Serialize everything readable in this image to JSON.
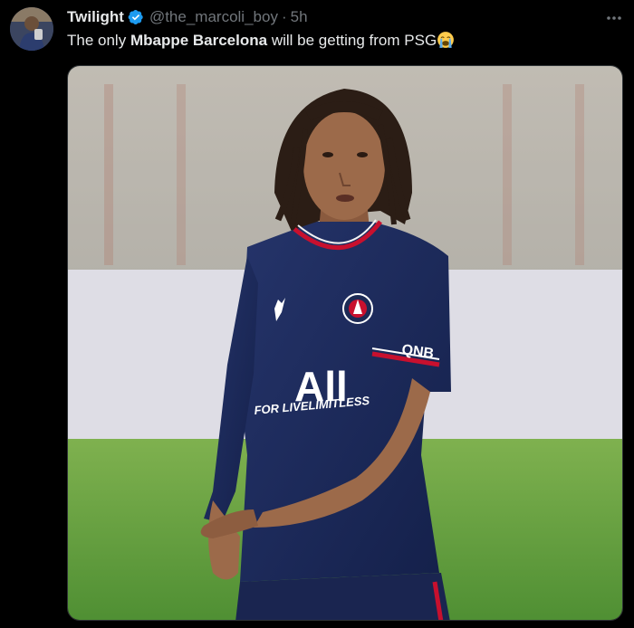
{
  "tweet": {
    "author_name": "Twilight",
    "handle": "@the_marcoli_boy",
    "separator": "·",
    "time": "5h",
    "text_parts": {
      "t1": "The only ",
      "b1": "Mbappe Barcelona",
      "t2": " will be getting from PSG"
    },
    "emoji": "crying-face-icon",
    "more_label": "···"
  },
  "media": {
    "shirt_text": {
      "sponsor": "All",
      "sub": "FOR LIVELIMITLESS",
      "brand": "QNB"
    },
    "colors": {
      "shirt": "#1c2a55",
      "trim": "#c8102e",
      "grass": "#5a9a3a",
      "background": "#d8d5cf"
    }
  },
  "colors": {
    "background": "#000000",
    "text": "#e7e9ea",
    "muted": "#71767b",
    "verified": "#1d9bf0"
  }
}
